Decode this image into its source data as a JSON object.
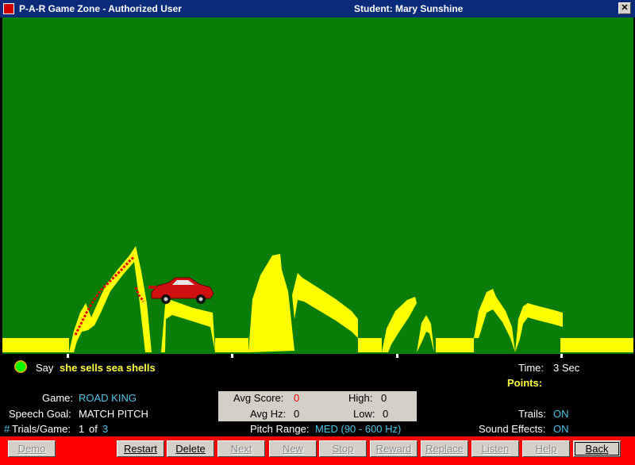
{
  "window": {
    "title": "P-A-R Game Zone - Authorized User",
    "student": "Student:  Mary Sunshine",
    "close_glyph": "✕"
  },
  "prompt": {
    "say_label": "Say",
    "phrase": "she sells sea shells"
  },
  "time": {
    "label": "Time:",
    "value": "3 Sec"
  },
  "points": {
    "label": "Points:"
  },
  "settings": {
    "game_label": "Game:",
    "game_value": "ROAD KING",
    "goal_label": "Speech Goal:",
    "goal_value": "MATCH  PITCH",
    "trials_label": "Trials/Game:",
    "trials_hash": "#",
    "trials_current": "1",
    "trials_of": "of",
    "trials_total": "3",
    "pitch_label": "Pitch Range:",
    "pitch_value": "MED  (90 - 600 Hz)",
    "trails_label": "Trails:",
    "trails_value": "ON",
    "sound_label": "Sound  Effects:",
    "sound_value": "ON"
  },
  "scores": {
    "avg_score_label": "Avg Score:",
    "avg_score_value": "0",
    "high_label": "High:",
    "high_value": "0",
    "avg_hz_label": "Avg Hz:",
    "avg_hz_value": "0",
    "low_label": "Low:",
    "low_value": "0"
  },
  "buttons": {
    "demo": "Demo",
    "restart": "Restart",
    "delete": "Delete",
    "next": "Next",
    "new": "New",
    "stop": "Stop",
    "reward": "Reward",
    "replace": "Replace",
    "listen": "Listen",
    "help": "Help",
    "back": "Back"
  },
  "colors": {
    "field": "#087d08",
    "road": "#ffff00",
    "trail": "#e00000",
    "car": "#d01010",
    "button_bar": "#ff0000",
    "accent_text": "#4fc3e8"
  }
}
